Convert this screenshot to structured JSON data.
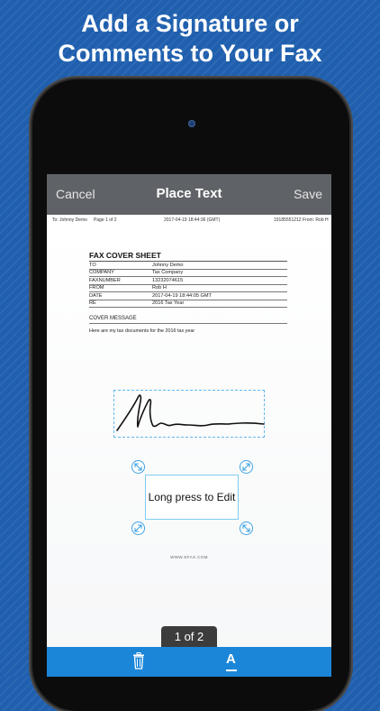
{
  "promo": {
    "line1": "Add a Signature or",
    "line2": "Comments to Your Fax"
  },
  "navbar": {
    "cancel": "Cancel",
    "title": "Place Text",
    "save": "Save"
  },
  "fax_header": {
    "to": "To: Johnny Demo",
    "page": "Page 1 of 2",
    "date": "2017-04-19 18:44:36 (GMT)",
    "from": "19185551212  From: Rob H"
  },
  "cover_sheet": {
    "title": "FAX COVER SHEET",
    "rows": [
      {
        "label": "TO",
        "value": "Johnny Demo"
      },
      {
        "label": "COMPANY",
        "value": "Tax Company"
      },
      {
        "label": "FAXNUMBER",
        "value": "13232074615"
      },
      {
        "label": "FROM",
        "value": "Rob H"
      },
      {
        "label": "DATE",
        "value": "2017-04-19 18:44:05 GMT"
      },
      {
        "label": "RE",
        "value": "2016 Tax Year"
      }
    ],
    "message_title": "COVER MESSAGE",
    "message_text": "Here are my tax documents for the 2016 tax year"
  },
  "text_box": {
    "text": "Long press to Edit"
  },
  "footer_url": "WWW.EFAX.COM",
  "pager": {
    "label": "1 of 2"
  },
  "toolbar": {
    "delete_icon": "trash-icon",
    "font_icon": "font-icon",
    "font_glyph": "A"
  },
  "colors": {
    "background": "#1f5fae",
    "navbar": "#5f6266",
    "toolbar": "#1b86d8",
    "accent": "#3ea1e3"
  }
}
